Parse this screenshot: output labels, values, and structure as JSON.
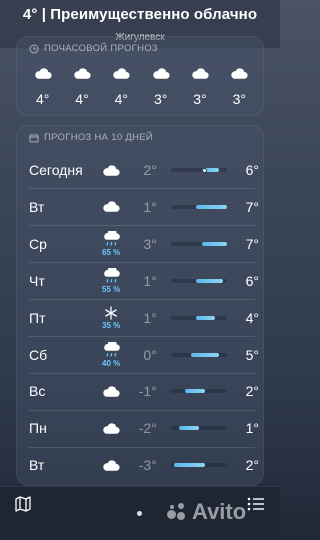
{
  "header": {
    "summary": "4° | Преимущественно облачно",
    "location": "Жигулевск"
  },
  "hourly": {
    "title": "ПОЧАСОВОЙ ПРОГНОЗ",
    "icon": "clock-icon",
    "items": [
      {
        "icon": "cloud-icon",
        "temp": "4°"
      },
      {
        "icon": "cloud-icon",
        "temp": "4°"
      },
      {
        "icon": "cloud-icon",
        "temp": "4°"
      },
      {
        "icon": "cloud-icon",
        "temp": "3°"
      },
      {
        "icon": "cloud-icon",
        "temp": "3°"
      },
      {
        "icon": "cloud-icon",
        "temp": "3°"
      }
    ]
  },
  "daily": {
    "title": "ПРОГНОЗ НА 10 ДНЕЙ",
    "icon": "calendar-icon",
    "days": [
      {
        "day": "Сегодня",
        "icon": "cloud-icon",
        "precip": "",
        "low": "2°",
        "high": "6°",
        "range": [
          0.55,
          0.85
        ],
        "current": 0.6
      },
      {
        "day": "Вт",
        "icon": "cloud-icon",
        "precip": "",
        "low": "1°",
        "high": "7°",
        "range": [
          0.45,
          1.0
        ]
      },
      {
        "day": "Ср",
        "icon": "rain-cloud-icon",
        "precip": "65 %",
        "low": "3°",
        "high": "7°",
        "range": [
          0.55,
          1.0
        ]
      },
      {
        "day": "Чт",
        "icon": "rain-cloud-icon",
        "precip": "55 %",
        "low": "1°",
        "high": "6°",
        "range": [
          0.45,
          0.92
        ]
      },
      {
        "day": "Пт",
        "icon": "snowflake-icon",
        "precip": "35 %",
        "low": "1°",
        "high": "4°",
        "range": [
          0.45,
          0.78
        ]
      },
      {
        "day": "Сб",
        "icon": "rain-cloud-icon",
        "precip": "40 %",
        "low": "0°",
        "high": "5°",
        "range": [
          0.35,
          0.85
        ]
      },
      {
        "day": "Вс",
        "icon": "cloud-icon",
        "precip": "",
        "low": "-1°",
        "high": "2°",
        "range": [
          0.25,
          0.6
        ]
      },
      {
        "day": "Пн",
        "icon": "cloud-icon",
        "precip": "",
        "low": "-2°",
        "high": "1°",
        "range": [
          0.15,
          0.5
        ]
      },
      {
        "day": "Вт",
        "icon": "cloud-icon",
        "precip": "",
        "low": "-3°",
        "high": "2°",
        "range": [
          0.05,
          0.6
        ]
      }
    ]
  },
  "toolbar": {
    "map_icon": "map-icon",
    "list_icon": "list-icon"
  },
  "watermark": {
    "text": "Avito"
  },
  "colors": {
    "bar": "#6ec3ff",
    "precip": "#6ec3ff"
  }
}
